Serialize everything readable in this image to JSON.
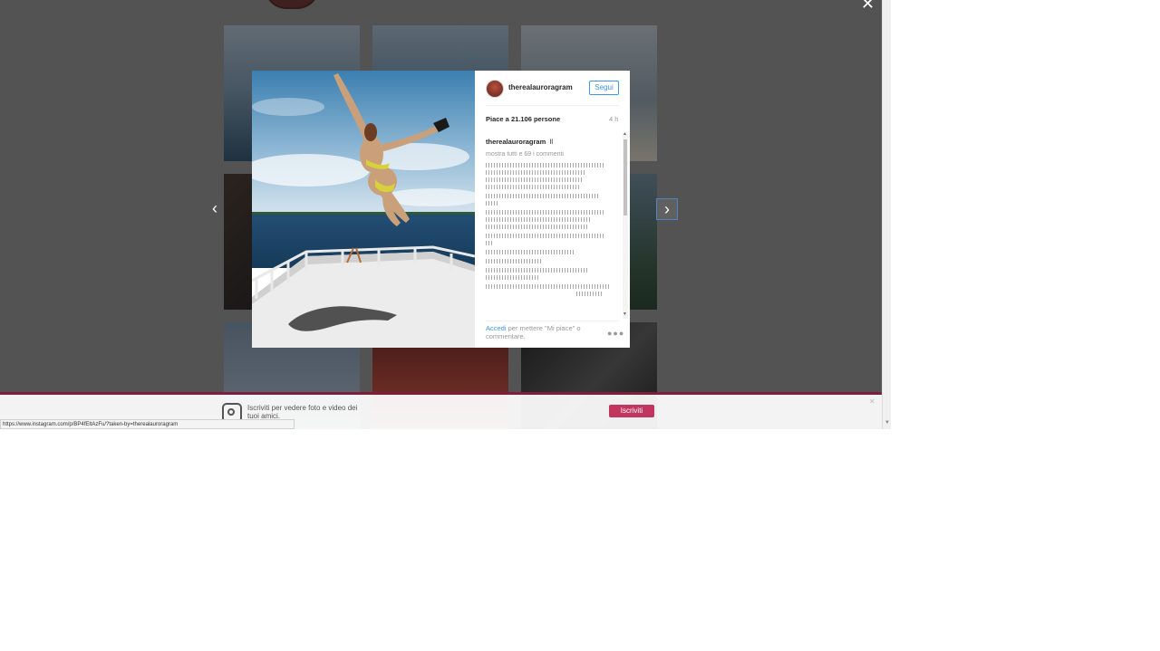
{
  "modal": {
    "username": "therealauroragram",
    "follow_label": "Segui",
    "likes_text": "Piace a 21.106 persone",
    "time_ago": "4 h",
    "caption_user": "therealauroragram",
    "caption_text": "ll",
    "show_comments": "mostra tutti e 69 i commenti",
    "login_link": "Accedi",
    "login_rest": " per mettere \"Mi piace\" o commentare."
  },
  "banner": {
    "text": "Iscriviti per vedere foto e video dei tuoi amici.",
    "signup_label": "Iscriviti"
  },
  "status_bar": {
    "url": "https://www.instagram.com/p/BP4fEltAzFu/?taken-by=therealauroragram"
  },
  "icons": {
    "prev": "chevron-left-icon",
    "next": "chevron-right-icon",
    "close": "close-icon",
    "more": "more-icon"
  }
}
